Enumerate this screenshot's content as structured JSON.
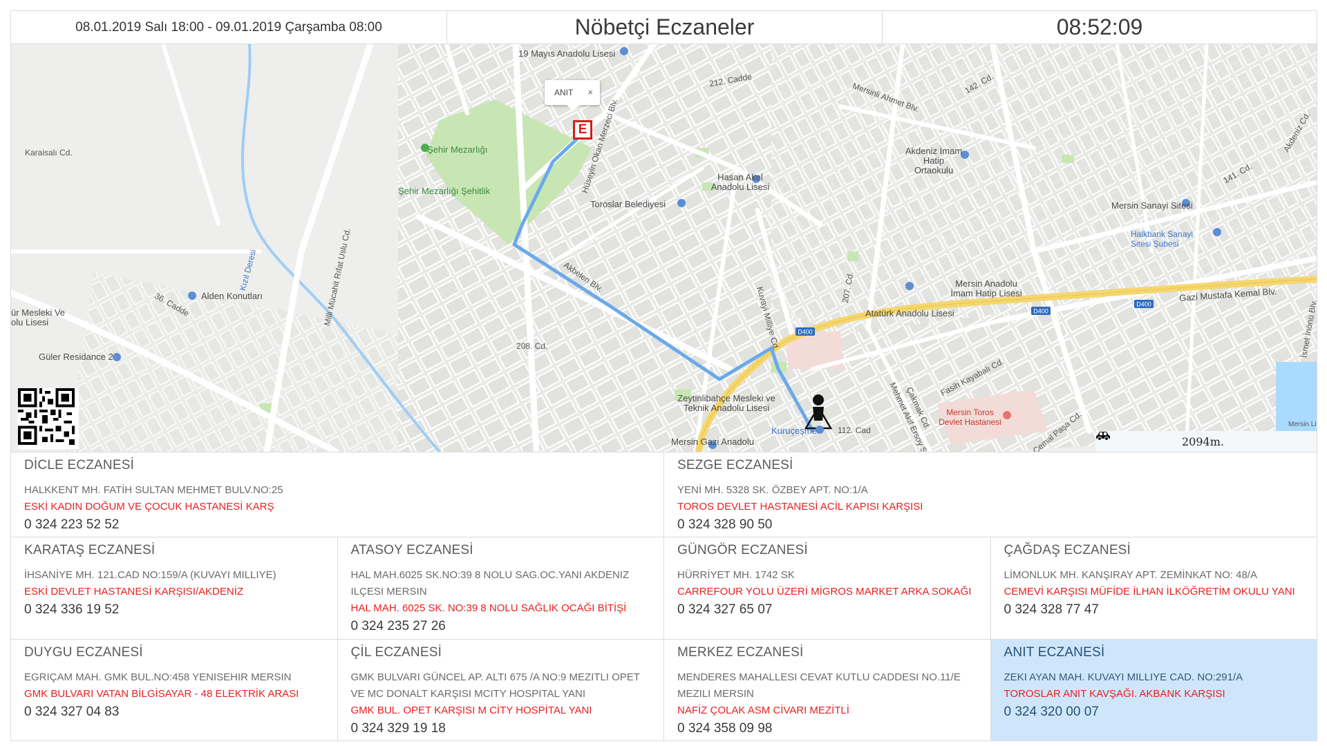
{
  "header": {
    "date_range": "08.01.2019 Salı 18:00 - 09.01.2019 Çarşamba 08:00",
    "title": "Nöbetçi Eczaneler",
    "clock": "08:52:09"
  },
  "map": {
    "info_window_label": "ANIT",
    "info_window_close": "×",
    "marker_letter": "E",
    "distance": "2094m.",
    "labels": {
      "l1": "19 Mayıs Anadolu Lisesi",
      "l2": "Şehir Mezarlığı",
      "l3": "Şehir Mezarlığı Şehitlik",
      "l4": "Toroslar Belediyesi",
      "l5": "Hasan Akel Anadolu Lisesi",
      "l6": "Akdeniz İmam Hatip Ortaokulu",
      "l7": "Mersin Sanayi Sitesi",
      "l8": "Halkbank Sanayi Sitesi Şubesi",
      "l9": "Alden Konutları",
      "l10": "Mersin Anadolu İmam Hatip Lisesi",
      "l11": "Atatürk Anadolu Lisesi",
      "l12": "Gazi Mustafa Kemal Blv.",
      "l13": "Güler Residance 2",
      "l14": "Zeytinlibahçe Mesleki ve Teknik Anadolu Lisesi",
      "l15": "Mersin Toros Devlet Hastanesi",
      "l16": "Kuruçeşme",
      "l17": "Mersin Gazi Anadolu",
      "l18": "Akbelen Blv.",
      "l19": "Hüseyin Okan Merzeci Blv.",
      "l20": "Milli Mücahit Rıfat Uslu Cd.",
      "l21": "Kuvayi Milliye Cd.",
      "l22": "Mehmet Akif Ersoy Sk.",
      "l23": "Çakmak Cd.",
      "l24": "Cemal Paşa Cd.",
      "l25": "Kızıl Deresi",
      "l26": "36. Cadde",
      "l27": "212. Cadde",
      "l28": "Mersinli Ahmet Blv.",
      "l29": "142. Cd.",
      "l30": "141. Cd.",
      "l31": "Akdeniz Cd.",
      "l32": "D400",
      "l33": "Karaisalı Cd.",
      "l34": "207. Cd.",
      "l35": "208. Cd.",
      "l36": "İsmet İnönü Blv.",
      "l37": "ür Mesleki Ve olu Lisesi",
      "l38": "Fasih Kayabalı Cd.",
      "l39": "112. Cad",
      "l40": "Mersin Limanı"
    }
  },
  "pharmacies": [
    {
      "name": "DİCLE ECZANESİ",
      "address": "HALKKENT MH. FATİH SULTAN MEHMET BULV.NO:25",
      "description": "ESKİ KADIN DOĞUM VE ÇOCUK HASTANESİ KARŞ",
      "phone": "0 324 223 52 52"
    },
    {
      "name": "SEZGE ECZANESİ",
      "address": "YENİ MH. 5328 SK. ÖZBEY APT. NO:1/A",
      "description": "TOROS DEVLET HASTANESİ ACİL KAPISI KARŞISI",
      "phone": "0 324 328 90 50"
    },
    {
      "name": "KARATAŞ ECZANESİ",
      "address": "İHSANİYE MH. 121.CAD NO:159/A (KUVAYI MILLIYE)",
      "description": "ESKİ DEVLET HASTANESİ KARŞISI/AKDENİZ",
      "phone": "0 324 336 19 52"
    },
    {
      "name": "ATASOY ECZANESİ",
      "address": "HAL MAH.6025 SK.NO:39 8 NOLU SAG.OC.YANI AKDENIZ ILÇESI MERSIN",
      "description": "HAL MAH. 6025 SK. NO:39 8 NOLU SAĞLIK OCAĞI BİTİŞİ",
      "phone": "0 324 235 27 26"
    },
    {
      "name": "GÜNGÖR ECZANESİ",
      "address": "HÜRRİYET MH. 1742 SK",
      "description": "CARREFOUR YOLU ÜZERİ MİGROS MARKET ARKA SOKAĞI",
      "phone": "0 324 327 65 07"
    },
    {
      "name": "ÇAĞDAŞ ECZANESİ",
      "address": "LİMONLUK MH. KANŞIRAY APT. ZEMİNKAT NO: 48/A",
      "description": "CEMEVİ KARŞISI MÜFİDE İLHAN İLKÖĞRETİM OKULU YANI",
      "phone": "0 324 328 77 47"
    },
    {
      "name": "DUYGU ECZANESİ",
      "address": "EGRIÇAM MAH. GMK BUL.NO:458 YENISEHIR MERSIN",
      "description": "GMK BULVARI VATAN BİLGİSAYAR - 48 ELEKTRİK ARASI",
      "phone": "0 324 327 04 83"
    },
    {
      "name": "ÇİL ECZANESİ",
      "address": "GMK BULVARI GÜNCEL AP. ALTI 675 /A NO:9 MEZITLI OPET VE MC DONALT KARŞISI MCITY HOSPITAL YANI",
      "description": "GMK BUL. OPET KARŞISI M CİTY HOSPİTAL YANI",
      "phone": "0 324 329 19 18"
    },
    {
      "name": "MERKEZ ECZANESİ",
      "address": "MENDERES MAHALLESI CEVAT KUTLU CADDESI NO.11/E MEZILI MERSIN",
      "description": "NAFİZ ÇOLAK ASM CİVARI MEZİTLİ",
      "phone": "0 324 358 09 98"
    },
    {
      "name": "ANIT ECZANESİ",
      "address": "ZEKI AYAN MAH. KUVAYI MILLIYE CAD. NO:291/A",
      "description": "TOROSLAR ANIT KAVŞAĞI. AKBANK KARŞISI",
      "phone": "0 324 320 00 07"
    }
  ],
  "colors": {
    "accent_red": "#e82020",
    "active_card_bg": "#cfe6fa",
    "route_blue": "#6aa9ec",
    "road_yellow": "#f5d76e"
  }
}
